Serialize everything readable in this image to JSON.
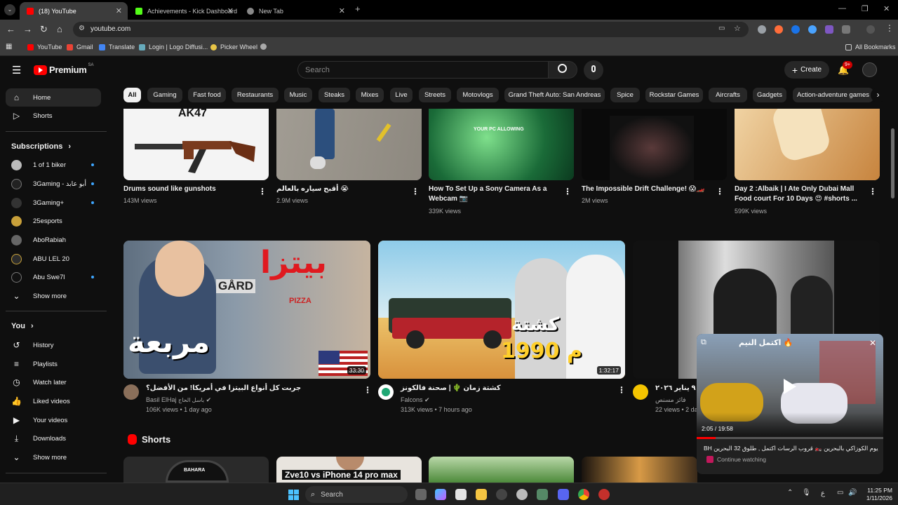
{
  "browser": {
    "tabs": [
      {
        "title": "(18) YouTube",
        "active": true
      },
      {
        "title": "Achievements - Kick Dashboard",
        "active": false
      },
      {
        "title": "New Tab",
        "active": false
      }
    ],
    "url": "youtube.com",
    "bookmarks": [
      "YouTube",
      "Gmail",
      "Translate",
      "Login | Logo Diffusi...",
      "Picker Wheel"
    ],
    "all_bookmarks": "All Bookmarks"
  },
  "masthead": {
    "logo": "Premium",
    "region": "SA",
    "search_placeholder": "Search",
    "create_label": "Create",
    "notifications_badge": "9+"
  },
  "chips": [
    "All",
    "Gaming",
    "Fast food",
    "Restaurants",
    "Music",
    "Steaks",
    "Mixes",
    "Live",
    "Streets",
    "Motovlogs",
    "Grand Theft Auto: San Andreas",
    "Spice",
    "Rockstar Games",
    "Aircrafts",
    "Gadgets",
    "Action-adventure games"
  ],
  "sidebar": {
    "main": [
      {
        "label": "Home",
        "icon": "home-icon"
      },
      {
        "label": "Shorts",
        "icon": "shorts-icon"
      }
    ],
    "subscriptions_header": "Subscriptions",
    "subscriptions": [
      {
        "label": "1 of 1 biker",
        "dot": true
      },
      {
        "label": "3Gaming - أبو عابد",
        "dot": true
      },
      {
        "label": "3Gaming+",
        "dot": true
      },
      {
        "label": "25esports",
        "dot": false
      },
      {
        "label": "AboRabiah",
        "dot": false
      },
      {
        "label": "ABU LEL 20",
        "dot": false
      },
      {
        "label": "Abu Swe7l",
        "dot": true
      }
    ],
    "show_more": "Show more",
    "you_header": "You",
    "you": [
      {
        "label": "History",
        "icon": "history-icon"
      },
      {
        "label": "Playlists",
        "icon": "playlists-icon"
      },
      {
        "label": "Watch later",
        "icon": "watch-later-icon"
      },
      {
        "label": "Liked videos",
        "icon": "like-icon"
      },
      {
        "label": "Your videos",
        "icon": "your-videos-icon"
      },
      {
        "label": "Downloads",
        "icon": "download-icon"
      }
    ],
    "show_more_2": "Show more"
  },
  "row1": [
    {
      "title": "Drums sound like gunshots",
      "title2": "",
      "meta": "143M views",
      "thumb_text": "AK47"
    },
    {
      "title": "أقبح سياره بالعالم 😭",
      "title2": "",
      "meta": "2.9M views",
      "thumb_text": ""
    },
    {
      "title": "How To Set Up a Sony Camera As a",
      "title2": "Webcam 📷",
      "meta": "339K views",
      "thumb_text": "YOUR PC ALLOWING"
    },
    {
      "title": "The Impossible Drift Challenge! 😱🏎️",
      "title2": "",
      "meta": "2M views",
      "thumb_text": ""
    },
    {
      "title": "Day 2 :Albaik | I Ate Only Dubai Mall",
      "title2": "Food court For 10 Days 😍 #shorts ...",
      "meta": "599K views",
      "thumb_text": ""
    }
  ],
  "row2": [
    {
      "title": "جربت كل أنواع البيتزا في أمريكا! من الأفضل؟",
      "channel": "Basil ElHaj",
      "channel_ar": "باسل الحاج",
      "meta": "106K views • 1 day ago",
      "duration": "33:30",
      "thumb_text_top": "بيتزا",
      "thumb_text_bottom": "مربعة",
      "thumb_sign1": "GÅRD",
      "thumb_sign2": "PIZZA"
    },
    {
      "title": "كشتة زمان 🌵 | صحنة فالكونز",
      "channel": "Falcons",
      "meta": "313K views • 7 hours ago",
      "duration": "1:32:17",
      "thumb_text_top": "كشتة",
      "thumb_text_bottom": "1990 م"
    },
    {
      "title": "٩ يناير ٢٠٢٦ •",
      "channel": "فائز مسنص",
      "meta": "22 views • 2 da",
      "thumb_text_top": "",
      "thumb_text_bottom": ""
    }
  ],
  "shorts": {
    "header": "Shorts",
    "thumb_text": "Zve10 vs iPhone 14 pro max",
    "thumb_brand": "BAHARA"
  },
  "miniplayer": {
    "overlay_title": "اكتمل النيم 🔥",
    "time": "2:05 / 19:58",
    "title": "BH يوم الكوزاكي بالبحرين 🏍️ قروب الرسات اكتمل , طلوق 32 البحرين",
    "continue": "Continue watching"
  },
  "taskbar": {
    "search": "Search",
    "lang": "ع",
    "time": "11:25 PM",
    "date": "1/11/2026"
  }
}
